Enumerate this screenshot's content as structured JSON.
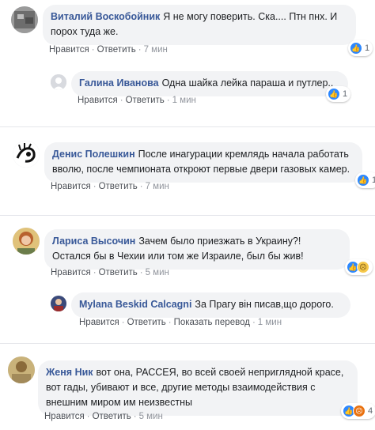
{
  "comments": [
    {
      "author": "Виталий Воскобойник",
      "text": "Я не могу поверить. Ска.... Птн пнх. И порох туда же.",
      "like": "Нравится",
      "reply": "Ответить",
      "time": "7 мин",
      "reaction_count": "1",
      "avatar_color": "#8a8a8a"
    },
    {
      "author": "Галина Иванова",
      "text": "Одна шайка лейка параша и путлер..",
      "like": "Нравится",
      "reply": "Ответить",
      "time": "1 мин",
      "reaction_count": "1",
      "avatar_color": "#c9ccd1"
    },
    {
      "author": "Денис Полешкин",
      "text": "После инагурации кремлядь начала работать вволю, после чемпионата откроют первые двери газовых камер.",
      "like": "Нравится",
      "reply": "Ответить",
      "time": "7 мин",
      "reaction_count": "1",
      "avatar_color": "#222222"
    },
    {
      "author": "Лариса Высочин",
      "text": "Зачем было приезжать в Украину?! Остался бы в Чехии или том же Израиле, был бы жив!",
      "like": "Нравится",
      "reply": "Ответить",
      "time": "5 мин",
      "reaction_count": "",
      "avatar_color": "#c9a24a"
    },
    {
      "author": "Mylana Beskid Calcagni",
      "text": "За Прагу він писав,що дорого.",
      "like": "Нравится",
      "reply": "Ответить",
      "translate": "Показать перевод",
      "time": "1 мин",
      "reaction_count": "",
      "avatar_color": "#7a3b2e"
    },
    {
      "author": "Женя Ник",
      "text": "вот она, РАССЕЯ, во всей своей неприглядной красе, вот гады, убивают и все, другие методы взаимодействия с внешним миром им неизвестны",
      "like": "Нравится",
      "reply": "Ответить",
      "time": "5 мин",
      "reaction_count": "4",
      "avatar_color": "#b59a5e"
    }
  ],
  "colors": {
    "author": "#385898",
    "bubble": "#f2f3f5",
    "meta": "#90949c",
    "like_icon": "#2d88ff"
  }
}
